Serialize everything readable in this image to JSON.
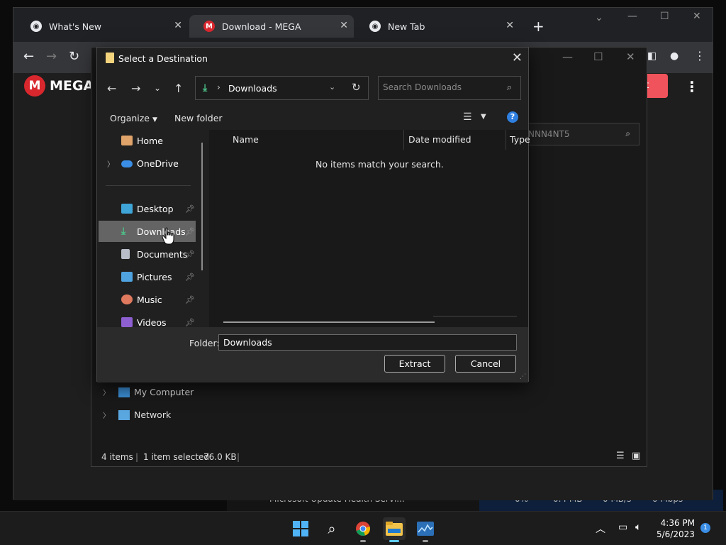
{
  "browser": {
    "tabs": [
      {
        "label": "What's New",
        "icon": "chrome-icon"
      },
      {
        "label": "Download - MEGA",
        "icon": "mega-icon"
      },
      {
        "label": "New Tab",
        "icon": "chrome-icon"
      }
    ],
    "new_tab": "+"
  },
  "mega": {
    "logo_text": "MEGA",
    "logo_badge": "M",
    "red_button_label": "nt"
  },
  "underlying_window": {
    "search_text": "NNN4NT5",
    "sidebar_items": [
      {
        "label": "My Computer",
        "icon": "computer-icon"
      },
      {
        "label": "Network",
        "icon": "network-icon"
      }
    ],
    "status": {
      "items": "4 items",
      "selected": "1 item selected",
      "size": "76.0 KB"
    }
  },
  "dialog": {
    "title": "Select a Destination",
    "address": {
      "path": "Downloads"
    },
    "search_placeholder": "Search Downloads",
    "commands": {
      "organize": "Organize",
      "new_folder": "New folder"
    },
    "nav_pane": [
      {
        "label": "Home",
        "icon": "home-icon",
        "pinned": false,
        "expandable": false
      },
      {
        "label": "OneDrive",
        "icon": "onedrive-icon",
        "pinned": false,
        "expandable": true
      },
      {
        "label": "Desktop",
        "icon": "desktop-icon",
        "pinned": true
      },
      {
        "label": "Downloads",
        "icon": "downloads-icon",
        "pinned": true,
        "selected": true
      },
      {
        "label": "Documents",
        "icon": "documents-icon",
        "pinned": true
      },
      {
        "label": "Pictures",
        "icon": "pictures-icon",
        "pinned": true
      },
      {
        "label": "Music",
        "icon": "music-icon",
        "pinned": true
      },
      {
        "label": "Videos",
        "icon": "videos-icon",
        "pinned": true
      }
    ],
    "columns": [
      "Name",
      "Date modified",
      "Type"
    ],
    "empty_message": "No items match your search.",
    "folder_label": "Folder:",
    "folder_value": "Downloads",
    "buttons": {
      "extract": "Extract",
      "cancel": "Cancel"
    }
  },
  "background_taskmgr": {
    "process": "Microsoft Update Health Servi...",
    "cpu": "0%",
    "memory": "0.4 MB",
    "disk": "0 MB/s",
    "network": "0 Mbps"
  },
  "taskbar": {
    "apps": [
      "start-icon",
      "search-icon",
      "chrome-icon",
      "file-explorer-icon",
      "task-manager-icon"
    ],
    "time": "4:36 PM",
    "date": "5/6/2023",
    "notifications": "1"
  },
  "colors": {
    "mega_red": "#d9272e",
    "selection": "#646464",
    "accent": "#60cdff"
  }
}
